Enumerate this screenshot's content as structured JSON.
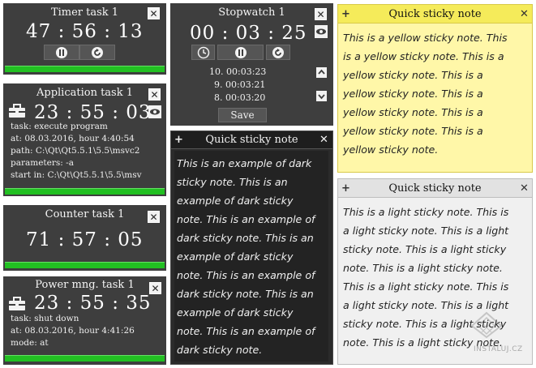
{
  "timer_task": {
    "title": "Timer task 1",
    "time": "47 : 56 : 13",
    "close_label": "✕"
  },
  "application_task": {
    "title": "Application task 1",
    "time": "23 : 55 : 03",
    "close_label": "✕",
    "lines": [
      "task:  execute program",
      "at:  08.03.2016, hour 4:40:54",
      "path:   C:\\Qt\\Qt5.5.1\\5.5\\msvc2",
      "parameters:   -a",
      "start in:   C:\\Qt\\Qt5.5.1\\5.5\\msv"
    ]
  },
  "counter_task": {
    "title": "Counter task 1",
    "time": "71 : 57 : 05",
    "close_label": "✕"
  },
  "power_task": {
    "title": "Power mng. task 1",
    "time": "23 : 55 : 35",
    "close_label": "✕",
    "lines": [
      "task:  shut down",
      "at:  08.03.2016, hour 4:41:26",
      "mode:   at"
    ]
  },
  "stopwatch": {
    "title": "Stopwatch 1",
    "time": "00 : 03 : 25",
    "close_label": "✕",
    "laps": [
      "10.  00:03:23",
      "9.  00:03:21",
      "8.  00:03:20"
    ],
    "save_label": "Save"
  },
  "dark_sticky": {
    "title": "Quick sticky note",
    "plus": "+",
    "close": "✕",
    "lines": [
      "This is an example of dark",
      "sticky note. This is an",
      "example of dark sticky",
      "note. This is an example of",
      "dark sticky note. This is an",
      "example of dark sticky",
      "note. This is an example of",
      "dark sticky note. This is an",
      "example of dark sticky",
      "note. This is an example of",
      "dark sticky note."
    ]
  },
  "yellow_sticky": {
    "title": "Quick sticky note",
    "plus": "+",
    "close": "✕",
    "lines": [
      "This is a yellow sticky note. This",
      "is a yellow sticky note. This is a",
      "yellow sticky note. This is a",
      "yellow sticky note. This is a",
      "yellow sticky note. This is a",
      "yellow sticky note. This is a",
      "yellow sticky note."
    ]
  },
  "light_sticky": {
    "title": "Quick sticky note",
    "plus": "+",
    "close": "✕",
    "lines": [
      "This is a light sticky note. This is",
      "a light sticky note. This is a light",
      "sticky note. This is a light sticky",
      "note. This is a light sticky note.",
      "This is a light sticky note. This is",
      "a light sticky note. This is a light",
      "sticky note. This is a light sticky",
      "note. This is a light sticky note."
    ]
  },
  "watermark": "INSTALUJ.CZ",
  "colors": {
    "panel": "#3e3e3e",
    "green": "#22c022",
    "yellow": "#fff7a8",
    "yellow_title": "#f5eb5a",
    "light": "#f0f0f0",
    "light_title": "#e2e2e2",
    "dark_sticky": "#2b2b2b"
  }
}
